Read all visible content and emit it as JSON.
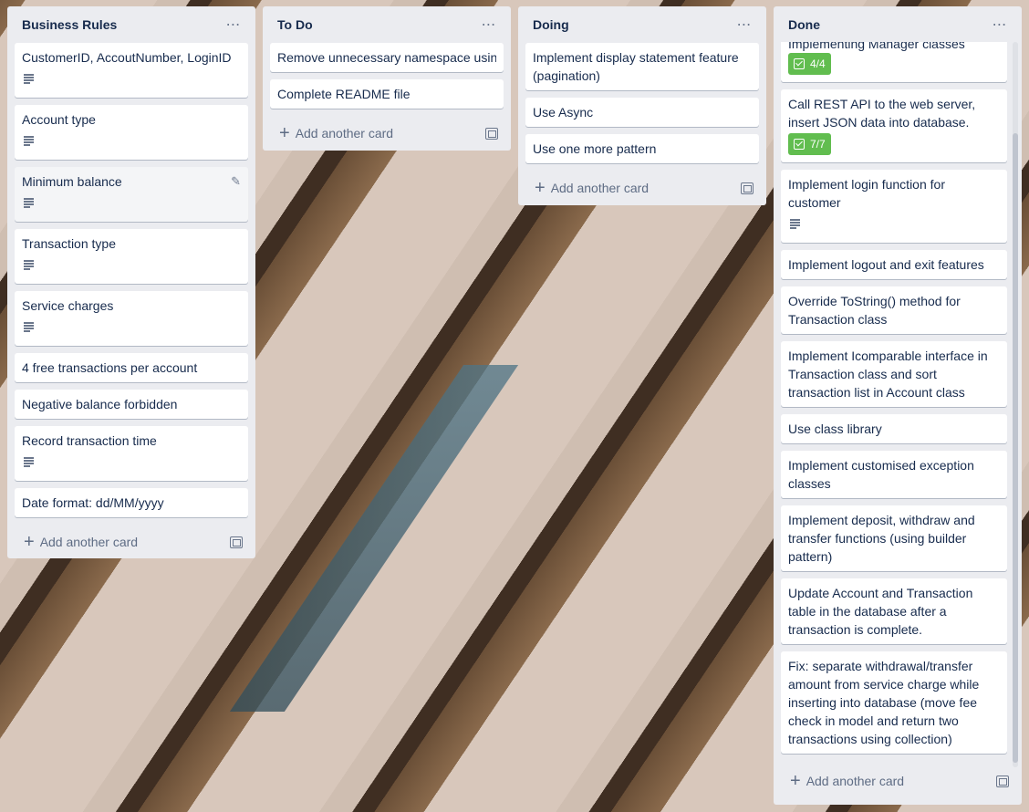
{
  "lists": [
    {
      "title": "Business Rules",
      "cards": [
        {
          "title": "CustomerID, AccoutNumber, LoginID",
          "has_description": true
        },
        {
          "title": "Account type",
          "has_description": true
        },
        {
          "title": "Minimum balance",
          "has_description": true
        },
        {
          "title": "Transaction type",
          "has_description": true
        },
        {
          "title": "Service charges",
          "has_description": true
        },
        {
          "title": "4 free transactions per account",
          "has_description": false
        },
        {
          "title": "Negative balance forbidden",
          "has_description": false
        },
        {
          "title": "Record transaction time",
          "has_description": true
        },
        {
          "title": "Date format: dd/MM/yyyy",
          "has_description": false
        }
      ],
      "add_label": "Add another card"
    },
    {
      "title": "To Do",
      "cards": [
        {
          "title": "Remove unnecessary namespace using"
        },
        {
          "title": "Complete README file"
        }
      ],
      "add_label": "Add another card"
    },
    {
      "title": "Doing",
      "cards": [
        {
          "title": "Implement display statement feature (pagination)"
        },
        {
          "title": "Use Async"
        },
        {
          "title": "Use one more pattern"
        }
      ],
      "add_label": "Add another card"
    },
    {
      "title": "Done",
      "cards": [
        {
          "title": "Implementing Manager classes",
          "checklist": "4/4"
        },
        {
          "title": "Call REST API to the web server, insert JSON data into database.",
          "checklist": "7/7"
        },
        {
          "title": "Implement login function for customer",
          "has_description": true
        },
        {
          "title": "Implement logout and exit features"
        },
        {
          "title": "Override ToString() method for Transaction class"
        },
        {
          "title": "Implement Icomparable interface in Transaction class and sort transaction list in Account class"
        },
        {
          "title": "Use class library"
        },
        {
          "title": "Implement customised exception classes"
        },
        {
          "title": "Implement deposit, withdraw and transfer functions (using builder pattern)"
        },
        {
          "title": "Update Account and Transaction table in the database after a transaction is complete."
        },
        {
          "title": "Fix: separate withdrawal/transfer amount from service charge while inserting into database (move fee check in model and return two transactions using collection)"
        }
      ],
      "add_label": "Add another card"
    }
  ],
  "icons": {
    "list_menu": "more-horizontal-icon",
    "description": "description-icon",
    "checklist": "checklist-icon",
    "edit": "pencil-icon",
    "add": "plus-icon",
    "template": "card-template-icon"
  },
  "colors": {
    "list_bg": "#ebecf0",
    "card_bg": "#ffffff",
    "checklist_complete": "#61bd4f"
  }
}
